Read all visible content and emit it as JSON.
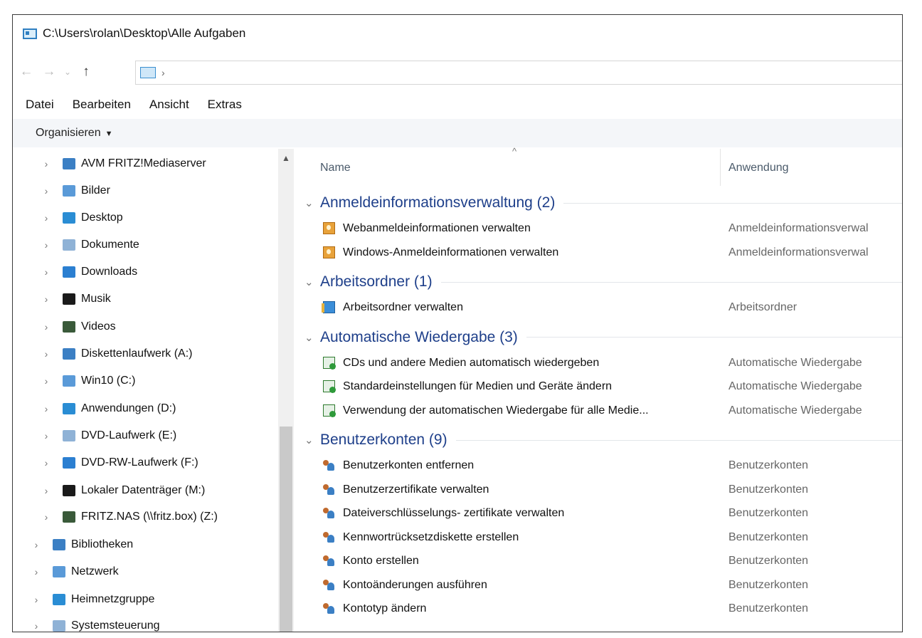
{
  "window": {
    "title": "C:\\Users\\rolan\\Desktop\\Alle Aufgaben"
  },
  "menu": [
    "Datei",
    "Bearbeiten",
    "Ansicht",
    "Extras"
  ],
  "commandbar": {
    "organize": "Organisieren"
  },
  "nav_items": [
    {
      "label": "AVM FRITZ!Mediaserver",
      "icon": "media-server-icon"
    },
    {
      "label": "Bilder",
      "icon": "pictures-icon"
    },
    {
      "label": "Desktop",
      "icon": "desktop-icon"
    },
    {
      "label": "Dokumente",
      "icon": "documents-icon"
    },
    {
      "label": "Downloads",
      "icon": "download-arrow-icon"
    },
    {
      "label": "Musik",
      "icon": "music-note-icon"
    },
    {
      "label": "Videos",
      "icon": "video-icon"
    },
    {
      "label": "Diskettenlaufwerk (A:)",
      "icon": "floppy-drive-icon"
    },
    {
      "label": "Win10 (C:)",
      "icon": "system-drive-icon"
    },
    {
      "label": "Anwendungen (D:)",
      "icon": "drive-icon"
    },
    {
      "label": "DVD-Laufwerk (E:)",
      "icon": "dvd-drive-icon"
    },
    {
      "label": "DVD-RW-Laufwerk (F:)",
      "icon": "dvd-drive-icon"
    },
    {
      "label": "Lokaler Datenträger (M:)",
      "icon": "drive-icon"
    },
    {
      "label": "FRITZ.NAS (\\\\fritz.box) (Z:)",
      "icon": "network-drive-icon"
    },
    {
      "label": "Bibliotheken",
      "icon": "libraries-icon"
    },
    {
      "label": "Netzwerk",
      "icon": "network-icon"
    },
    {
      "label": "Heimnetzgruppe",
      "icon": "homegroup-icon"
    },
    {
      "label": "Systemsteuerung",
      "icon": "control-panel-icon"
    }
  ],
  "columns": {
    "name": "Name",
    "app": "Anwendung"
  },
  "groups": [
    {
      "title": "Anmeldeinformationsverwaltung (2)",
      "icon": "credential-icon",
      "items": [
        {
          "name": "Webanmeldeinformationen verwalten",
          "app": "Anmeldeinformationsverwal"
        },
        {
          "name": "Windows-Anmeldeinformationen verwalten",
          "app": "Anmeldeinformationsverwal"
        }
      ]
    },
    {
      "title": "Arbeitsordner (1)",
      "icon": "work-folder-icon",
      "items": [
        {
          "name": "Arbeitsordner verwalten",
          "app": "Arbeitsordner"
        }
      ]
    },
    {
      "title": "Automatische Wiedergabe (3)",
      "icon": "autoplay-icon",
      "items": [
        {
          "name": "CDs und andere Medien automatisch wiedergeben",
          "app": "Automatische Wiedergabe"
        },
        {
          "name": "Standardeinstellungen für Medien und Geräte ändern",
          "app": "Automatische Wiedergabe"
        },
        {
          "name": "Verwendung der automatischen Wiedergabe für alle Medie...",
          "app": "Automatische Wiedergabe"
        }
      ]
    },
    {
      "title": "Benutzerkonten (9)",
      "icon": "user-accounts-icon",
      "items": [
        {
          "name": "Benutzerkonten entfernen",
          "app": "Benutzerkonten"
        },
        {
          "name": "Benutzerzertifikate verwalten",
          "app": "Benutzerkonten"
        },
        {
          "name": "Dateiverschlüsselungs- zertifikate verwalten",
          "app": "Benutzerkonten"
        },
        {
          "name": "Kennwortrücksetzdiskette erstellen",
          "app": "Benutzerkonten"
        },
        {
          "name": "Konto erstellen",
          "app": "Benutzerkonten"
        },
        {
          "name": "Kontoänderungen ausführen",
          "app": "Benutzerkonten"
        },
        {
          "name": "Kontotyp ändern",
          "app": "Benutzerkonten"
        }
      ]
    }
  ]
}
